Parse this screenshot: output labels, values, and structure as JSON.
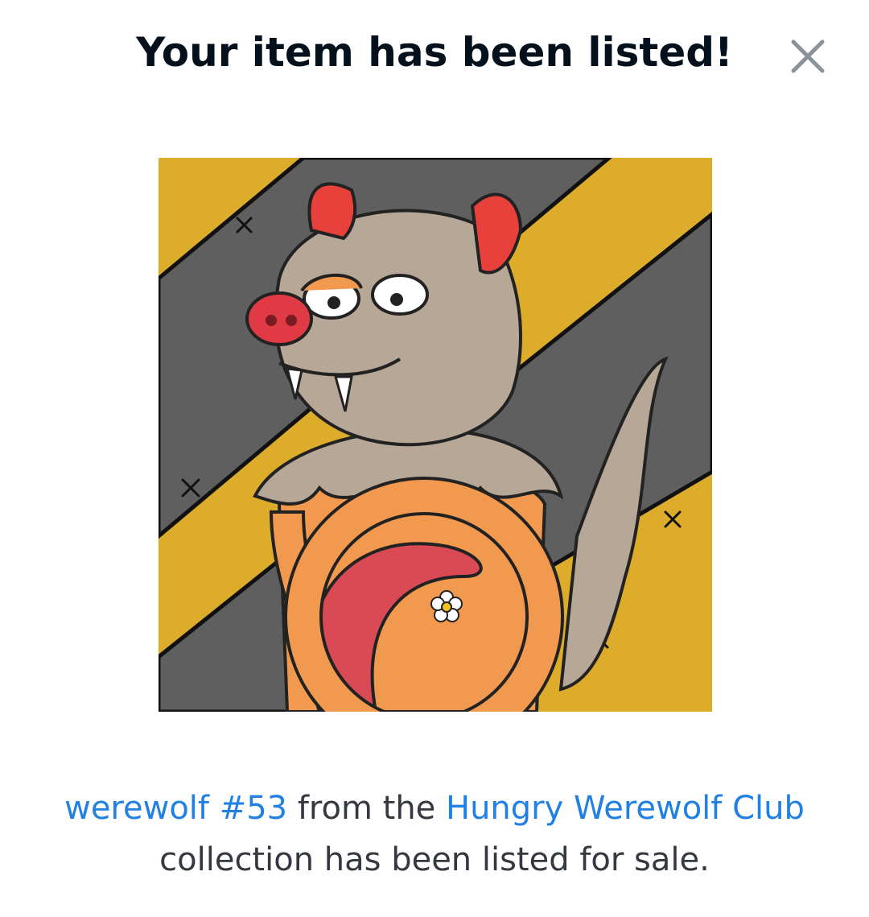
{
  "modal": {
    "title": "Your item has been listed!",
    "close_icon": "close-icon"
  },
  "item": {
    "image_icon": "werewolf-nft-artwork",
    "name": "werewolf #53",
    "collection": "Hungry Werewolf Club"
  },
  "message": {
    "from_text": " from the ",
    "suffix_text": " collection has been listed for sale."
  },
  "colors": {
    "title": "#04111d",
    "link": "#2081e2",
    "body_text": "#353840",
    "close_icon": "#8a939b"
  }
}
